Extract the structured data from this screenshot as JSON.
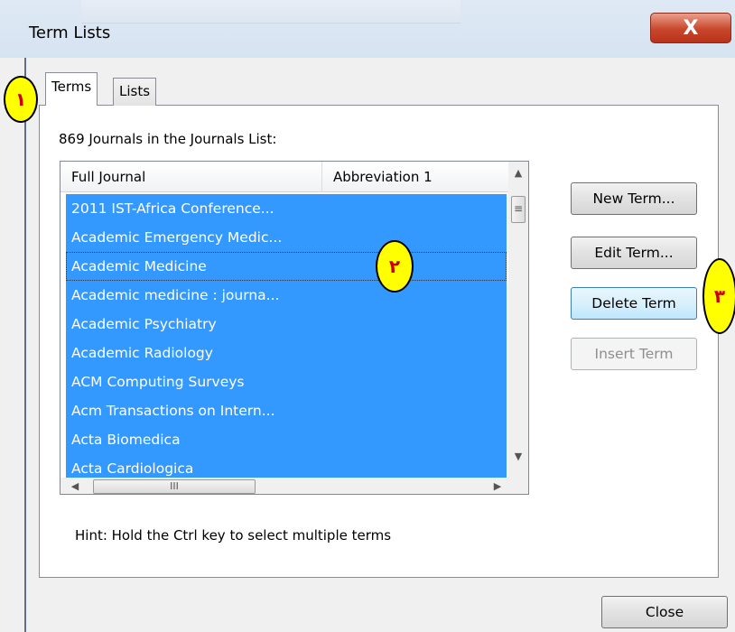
{
  "window": {
    "title": "Term Lists",
    "close_glyph": "X"
  },
  "tabs": [
    {
      "label": "Terms",
      "active": true
    },
    {
      "label": "Lists",
      "active": false
    }
  ],
  "list": {
    "count_label": "869 Journals in the Journals List:",
    "columns": [
      "Full Journal",
      "Abbreviation 1"
    ],
    "rows": [
      "2011 IST-Africa Conference...",
      "Academic Emergency Medic...",
      "Academic Medicine",
      "Academic medicine : journa...",
      "Academic Psychiatry",
      "Academic Radiology",
      "ACM Computing Surveys",
      "Acm Transactions on Intern...",
      "Acta Biomedica",
      "Acta Cardiologica"
    ],
    "focused_row_index": 2,
    "selection_color": "#3399ff"
  },
  "scrollbar_glyphs": {
    "up": "▲",
    "down": "▼",
    "left": "◀",
    "right": "▶",
    "vgrip": "≡",
    "hgrip": "III"
  },
  "buttons": {
    "new_term": "New Term...",
    "edit_term": "Edit Term...",
    "delete_term": "Delete Term",
    "insert_term": "Insert Term",
    "close": "Close"
  },
  "hint": "Hint: Hold the Ctrl key to select multiple terms",
  "annotations": [
    "١",
    "٢",
    "٣"
  ]
}
